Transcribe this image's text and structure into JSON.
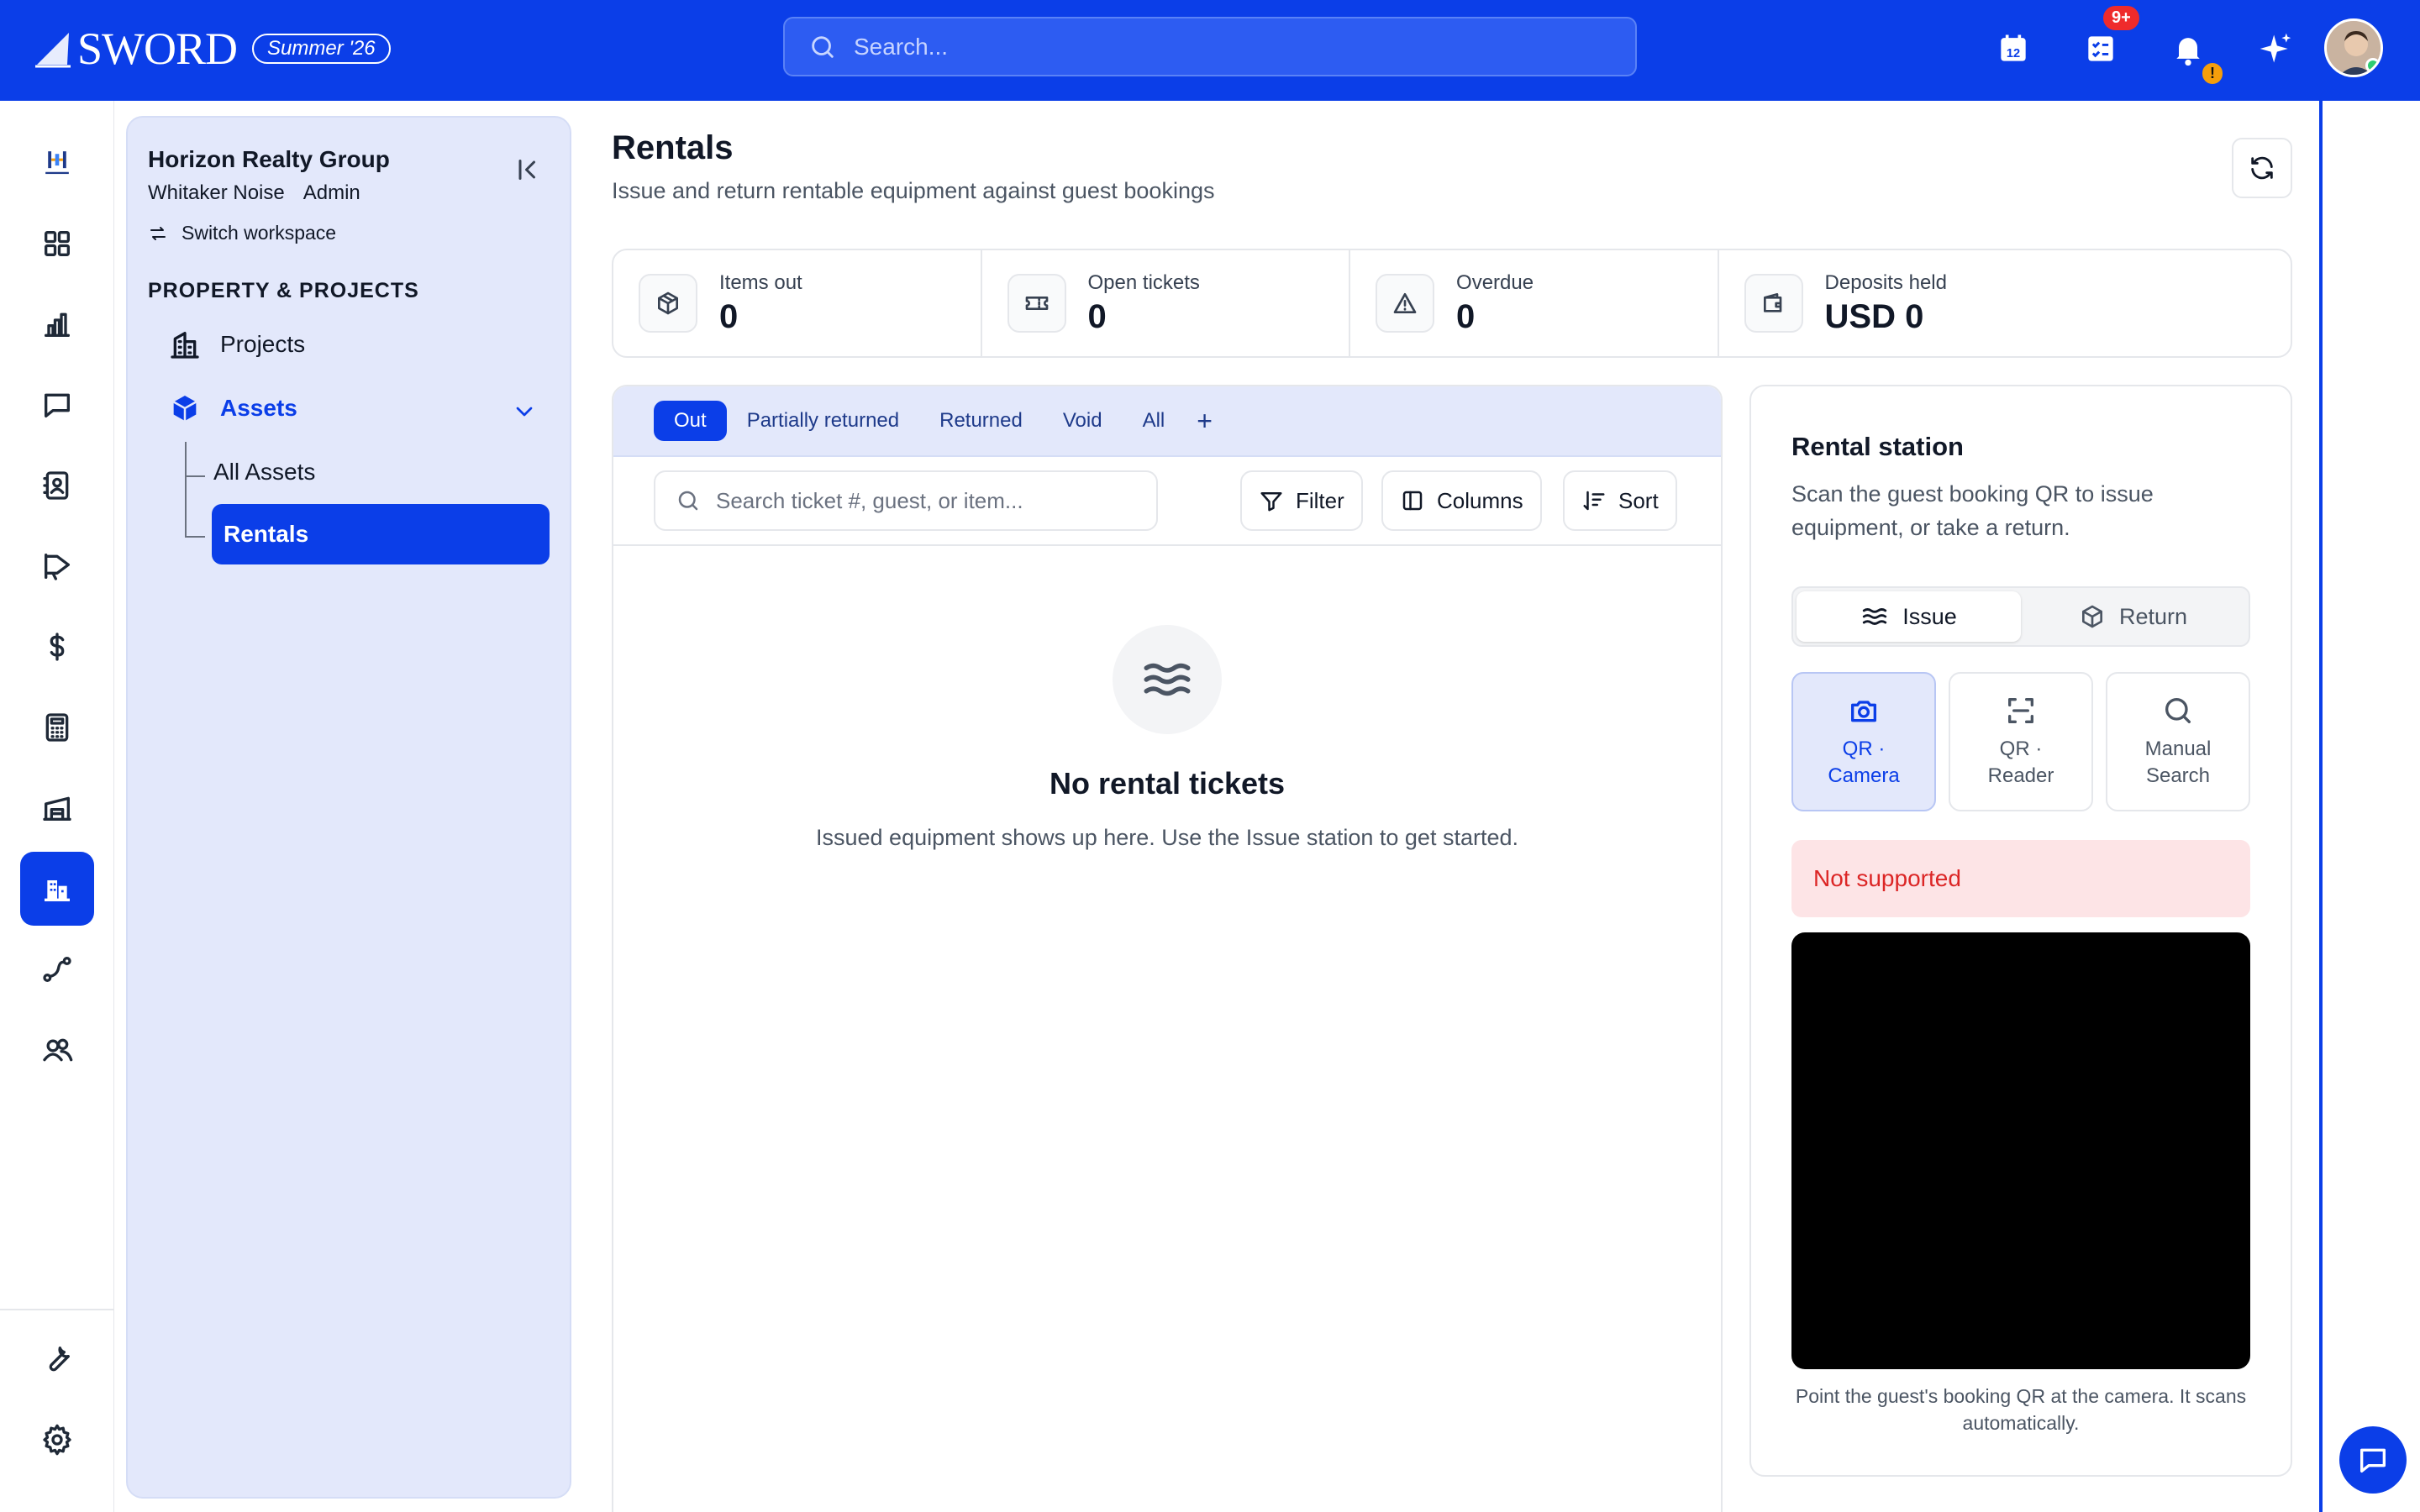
{
  "topbar": {
    "brand": "SWORD",
    "release_badge": "Summer '26",
    "search_placeholder": "Search...",
    "tasks_badge": "9+",
    "bell_badge": "!",
    "calendar_day": "12"
  },
  "rail": {
    "items": [
      "dashboard-icon",
      "analytics-icon",
      "chat-icon",
      "contacts-icon",
      "marketing-icon",
      "dollar-icon",
      "calculator-icon",
      "warehouse-icon",
      "buildings-icon",
      "workflow-icon",
      "users-icon"
    ],
    "active": "buildings-icon",
    "bottom": [
      "wrench-icon",
      "gear-icon"
    ]
  },
  "sidebar": {
    "org_name": "Horizon Realty Group",
    "user_name": "Whitaker Noise",
    "user_role": "Admin",
    "switch_label": "Switch workspace",
    "section_title": "PROPERTY & PROJECTS",
    "items": [
      {
        "label": "Projects",
        "icon": "building-icon"
      },
      {
        "label": "Assets",
        "icon": "cube-icon",
        "expanded": true
      },
      {
        "label": "All Assets"
      },
      {
        "label": "Rentals",
        "active": true
      }
    ]
  },
  "main": {
    "title": "Rentals",
    "subtitle": "Issue and return rentable equipment against guest bookings",
    "stats": [
      {
        "label": "Items out",
        "value": "0",
        "icon": "box-icon"
      },
      {
        "label": "Open tickets",
        "value": "0",
        "icon": "ticket-icon"
      },
      {
        "label": "Overdue",
        "value": "0",
        "icon": "warning-icon"
      },
      {
        "label": "Deposits held",
        "value": "USD 0",
        "icon": "wallet-icon"
      }
    ],
    "tabs": [
      "Out",
      "Partially returned",
      "Returned",
      "Void",
      "All"
    ],
    "active_tab": "Out",
    "add_tab": "+",
    "search_placeholder": "Search ticket #, guest, or item...",
    "filter_label": "Filter",
    "columns_label": "Columns",
    "sort_label": "Sort",
    "empty_title": "No rental tickets",
    "empty_subtitle": "Issued equipment shows up here. Use the Issue station to get started."
  },
  "station": {
    "title": "Rental station",
    "subtitle": "Scan the guest booking QR to issue equipment, or take a return.",
    "issue_label": "Issue",
    "return_label": "Return",
    "modes": [
      {
        "line1": "QR ·",
        "line2": "Camera",
        "active": true
      },
      {
        "line1": "QR ·",
        "line2": "Reader"
      },
      {
        "line1": "Manual",
        "line2": "Search"
      }
    ],
    "unsupported": "Not supported",
    "hint": "Point the guest's booking QR at the camera. It scans automatically."
  },
  "colors": {
    "primary": "#0b3ee8",
    "sidebar_bg": "#e3e8fb",
    "error_bg": "#fde4e6",
    "error_text": "#dc2626"
  }
}
